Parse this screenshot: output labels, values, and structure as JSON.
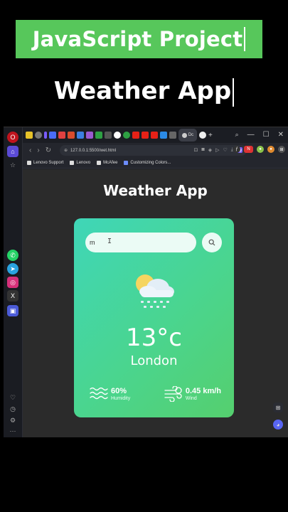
{
  "overlay": {
    "banner_title": "JavaScript Project",
    "subtitle": "Weather App"
  },
  "browser": {
    "url": "127.0.0.1:5500/wet.html",
    "tab_label": "Dc",
    "window_controls": [
      "—",
      "☐",
      "✕"
    ],
    "bookmarks": [
      "Lenovo Support",
      "Lenovo",
      "McAfee",
      "Customizing Colors..."
    ]
  },
  "page": {
    "heading": "Weather App",
    "search": {
      "value": "m",
      "placeholder": ""
    },
    "weather": {
      "icon": "cloud-sun-snow-icon",
      "temperature": "13°c",
      "city": "London",
      "humidity_value": "60%",
      "humidity_label": "Humidity",
      "wind_value": "0.45 km/h",
      "wind_label": "Wind"
    }
  },
  "colors": {
    "banner": "#57c75b",
    "card_gradient_start": "#3fd6b8",
    "card_gradient_end": "#55cf6e"
  }
}
